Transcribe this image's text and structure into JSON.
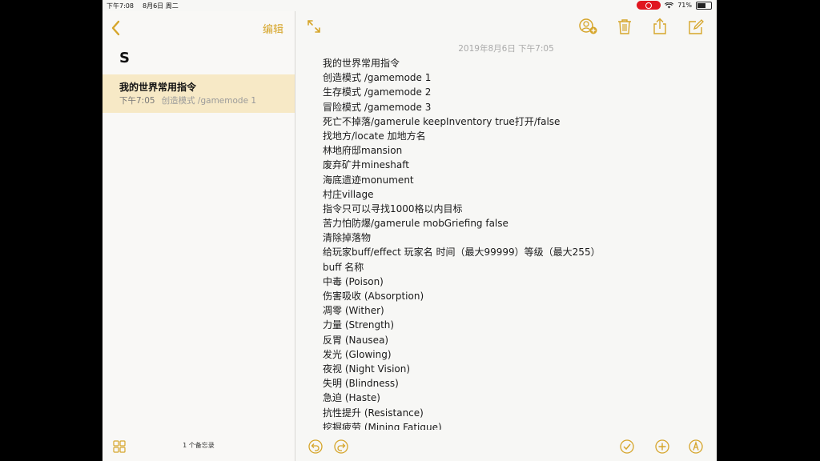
{
  "status": {
    "time": "下午7:08",
    "date": "8月6日 周二",
    "battery": "71%",
    "battery_level": 0.71
  },
  "sidebar": {
    "edit_label": "编辑",
    "folder_title": "S",
    "note": {
      "title": "我的世界常用指令",
      "time": "下午7:05",
      "snippet": "创造模式 /gamemode 1"
    },
    "count_label": "1 个备忘录"
  },
  "editor": {
    "date": "2019年8月6日 下午7:05",
    "lines": [
      "我的世界常用指令",
      "创造模式 /gamemode 1",
      "生存模式 /gamemode 2",
      "冒险模式 /gamemode 3",
      "死亡不掉落/gamerule keepInventory true打开/false",
      "找地方/locate 加地方名",
      "林地府邸mansion",
      "废弃矿井mineshaft",
      "海底遗迹monument",
      "村庄village",
      "指令只可以寻找1000格以内目标",
      "苦力怕防爆/gamerule mobGriefing false",
      "清除掉落物",
      "给玩家buff/effect 玩家名 时间（最大99999）等级（最大255）",
      "buff 名称",
      "中毒 (Poison)",
      "伤害吸收 (Absorption)",
      "凋零 (Wither)",
      "力量 (Strength)",
      "反胃 (Nausea)",
      "发光 (Glowing)",
      "夜视 (Night Vision)",
      "失明 (Blindness)",
      "急迫 (Haste)",
      "抗性提升 (Resistance)",
      "挖掘疲劳 (Mining Fatigue)"
    ]
  },
  "colors": {
    "accent": "#d6a52a",
    "selected_row": "#f7e9c6",
    "record": "#e0161f"
  },
  "icons": {
    "back": "chevron-left-icon",
    "expand": "expand-icon",
    "share_person": "add-person-icon",
    "trash": "trash-icon",
    "share": "share-icon",
    "compose": "compose-icon",
    "gallery": "gallery-icon",
    "undo": "undo-icon",
    "redo": "redo-icon",
    "checklist": "checklist-icon",
    "add": "add-icon",
    "markup": "markup-icon"
  }
}
